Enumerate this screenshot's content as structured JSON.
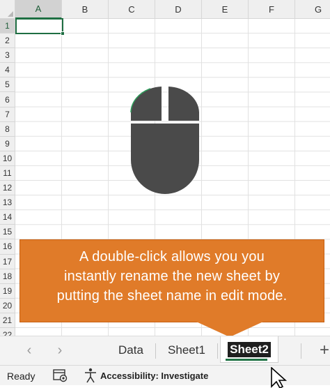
{
  "grid": {
    "columns": [
      "A",
      "B",
      "C",
      "D",
      "E",
      "F",
      "G"
    ],
    "rows": [
      "1",
      "2",
      "3",
      "4",
      "5",
      "6",
      "7",
      "8",
      "9",
      "10",
      "11",
      "12",
      "13",
      "14",
      "15",
      "16",
      "17",
      "18",
      "19",
      "20",
      "21",
      "22"
    ],
    "active_cell": "A1"
  },
  "callout": {
    "line1": "A double-click allows you you",
    "line2": "instantly rename the new sheet  by",
    "line3": "putting the sheet name in edit mode."
  },
  "tabs": {
    "prev_icon": "chevron-left-icon",
    "next_icon": "chevron-right-icon",
    "sheets": [
      "Data",
      "Sheet1"
    ],
    "active_sheet": "Sheet2",
    "add_label": "+"
  },
  "status": {
    "ready": "Ready",
    "accessibility": "Accessibility: Investigate"
  },
  "colors": {
    "accent_green": "#217346",
    "callout_orange": "#e07b29",
    "mouse_gray": "#4a4a4a"
  }
}
